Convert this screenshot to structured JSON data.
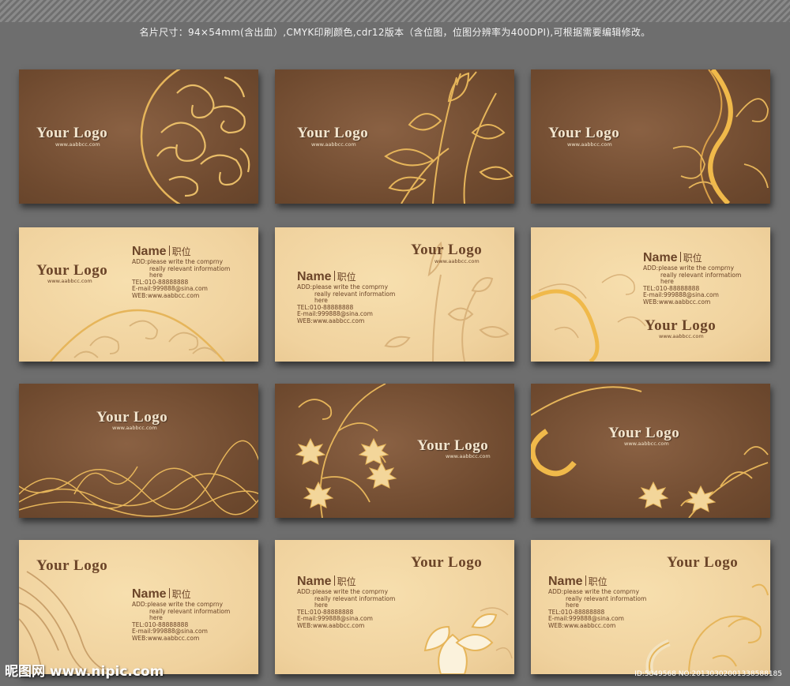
{
  "caption": "名片尺寸：94×54mm(含出血）,CMYK印刷颜色,cdr12版本（含位图，位图分辨率为400DPI),可根据需要编辑修改。",
  "brand": {
    "logo": "Your Logo",
    "website": "www.aabbcc.com"
  },
  "contact": {
    "name": "Name",
    "title": "职位",
    "add1": "ADD:please write the comprny",
    "add2": "really relevant informatiom",
    "add3": "here",
    "tel": "TEL:010-88888888",
    "email": "E-mail:999888@sina.com",
    "web": "WEB:www.aabbcc.com"
  },
  "footer": {
    "site": "昵图网 www.nipic.com",
    "id": "ID:5849568 NO:20130302001338588185"
  },
  "colors": {
    "dark_card": "#6f4a2f",
    "light_card": "#f0d29e",
    "text_brown": "#6b4428",
    "gold": "#e6b55a"
  }
}
